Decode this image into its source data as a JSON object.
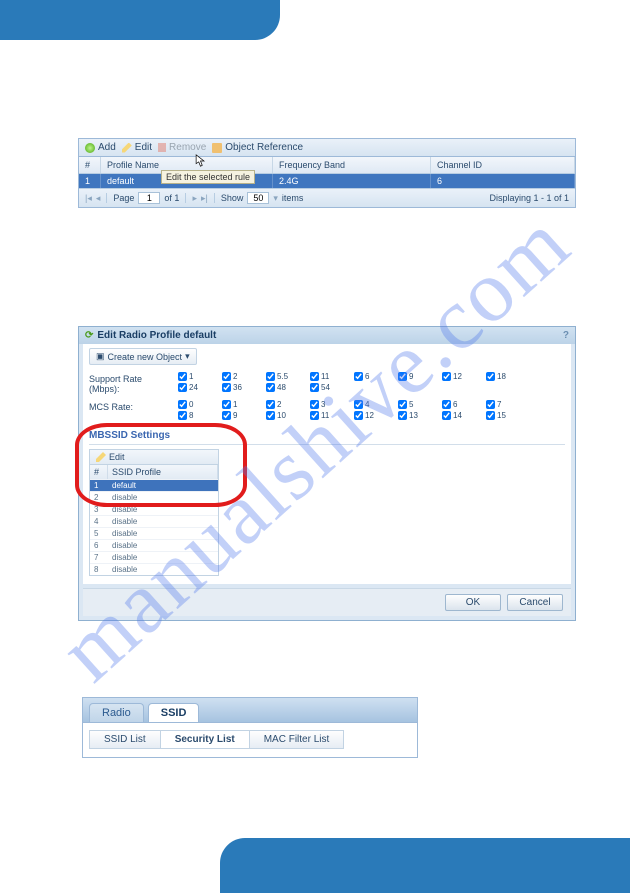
{
  "watermark": "manualshive.com",
  "panel1": {
    "toolbar": {
      "add": "Add",
      "edit": "Edit",
      "remove": "Remove",
      "objref": "Object Reference"
    },
    "columns": {
      "num": "#",
      "profile": "Profile Name",
      "band": "Frequency Band",
      "channel": "Channel ID"
    },
    "tooltip": "Edit the selected rule",
    "row": {
      "num": "1",
      "name": "default",
      "band": "2.4G",
      "channel": "6"
    },
    "pager": {
      "page_lbl": "Page",
      "page_val": "1",
      "of_lbl": "of 1",
      "show_lbl": "Show",
      "show_val": "50",
      "items_lbl": "items",
      "displaying": "Displaying 1 - 1 of 1"
    }
  },
  "panel2": {
    "title": "Edit Radio Profile default",
    "create": "Create new Object",
    "support_rate_lbl": "Support Rate (Mbps):",
    "mcs_rate_lbl": "MCS Rate:",
    "support_rates_row1": [
      "1",
      "2",
      "5.5",
      "11",
      "6",
      "9",
      "12",
      "18"
    ],
    "support_rates_row2": [
      "24",
      "36",
      "48",
      "54",
      "",
      "",
      "",
      ""
    ],
    "mcs_row1": [
      "0",
      "1",
      "2",
      "3",
      "4",
      "5",
      "6",
      "7"
    ],
    "mcs_row2": [
      "8",
      "9",
      "10",
      "11",
      "12",
      "13",
      "14",
      "15"
    ],
    "mbssid_heading": "MBSSID Settings",
    "mb_edit": "Edit",
    "mb_cols": {
      "num": "#",
      "profile": "SSID Profile"
    },
    "mb_rows": [
      {
        "n": "1",
        "p": "default",
        "sel": true
      },
      {
        "n": "2",
        "p": "disable"
      },
      {
        "n": "3",
        "p": "disable"
      },
      {
        "n": "4",
        "p": "disable"
      },
      {
        "n": "5",
        "p": "disable"
      },
      {
        "n": "6",
        "p": "disable"
      },
      {
        "n": "7",
        "p": "disable"
      },
      {
        "n": "8",
        "p": "disable"
      }
    ],
    "ok": "OK",
    "cancel": "Cancel"
  },
  "panel3": {
    "tabs": {
      "radio": "Radio",
      "ssid": "SSID"
    },
    "subtabs": {
      "ssid_list": "SSID List",
      "security_list": "Security List",
      "mac_filter": "MAC Filter List"
    }
  }
}
